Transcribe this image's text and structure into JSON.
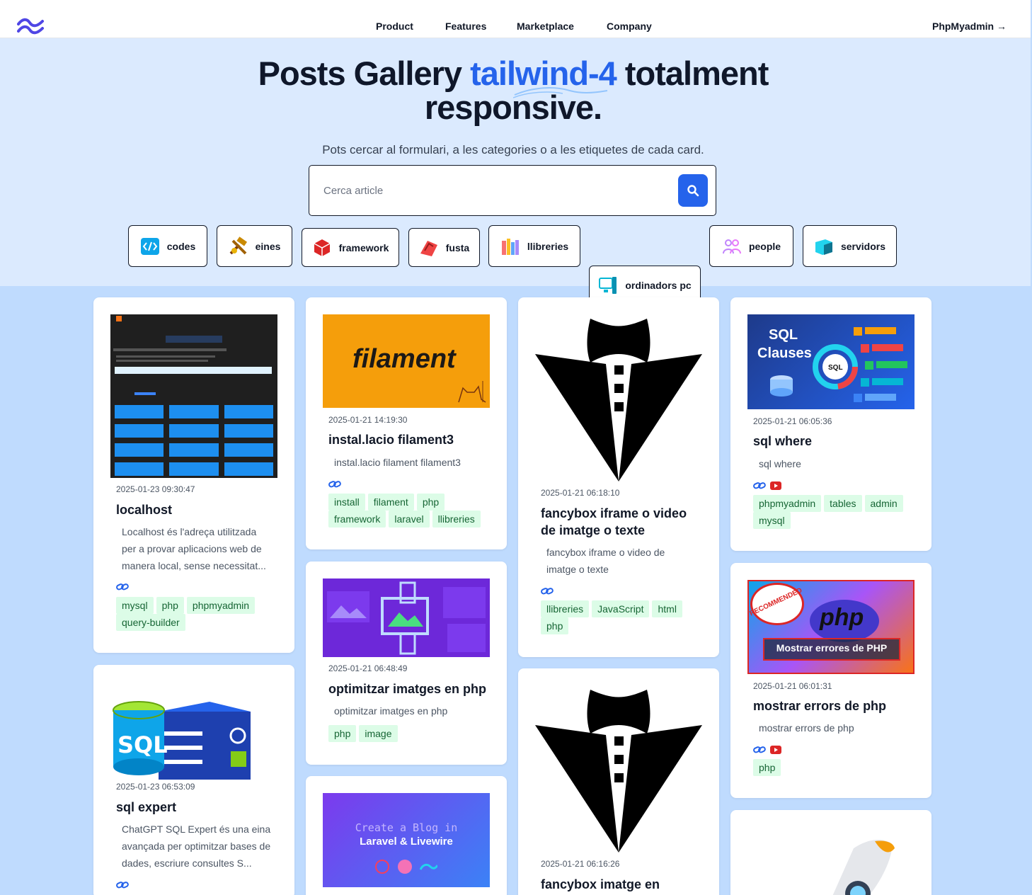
{
  "nav": {
    "items": [
      "Product",
      "Features",
      "Marketplace",
      "Company"
    ],
    "login": "PhpMyadmin →"
  },
  "hero": {
    "title_part1": "Posts Gallery",
    "title_accent": "tailwind-4",
    "title_part2": "totalment",
    "title_line2": "responsive.",
    "subtitle": "Pots cercar al formulari, a les categories o a les etiquetes de cada card."
  },
  "search": {
    "placeholder": "Cerca article"
  },
  "categories": [
    "codes",
    "eines",
    "framework",
    "fusta",
    "llibreries",
    "ordinadors pc",
    "people",
    "servidors"
  ],
  "colors": {
    "primary": "#2563eb",
    "hero_bg": "#dbeafe",
    "page_bg": "#bfdbfe",
    "tag_bg": "#dcfce7",
    "tag_text": "#166534"
  },
  "cards": [
    {
      "date": "2025-01-23 09:30:47",
      "title": "localhost",
      "desc": "Localhost és l'adreça utilitzada per a provar aplicacions web de manera local, sense necessitat...",
      "tags": [
        "mysql",
        "php",
        "phpmyadmin",
        "query-builder"
      ],
      "links": [
        "link-icon"
      ]
    },
    {
      "date": "2025-01-21 14:19:30",
      "title": "instal.lacio filament3",
      "desc": "instal.lacio filament filament3",
      "thumb_text": "filament",
      "tags": [
        "install",
        "filament",
        "php",
        "framework",
        "laravel",
        "llibreries"
      ],
      "links": [
        "link-icon"
      ]
    },
    {
      "date": "2025-01-21 06:18:10",
      "title": "fancybox iframe o video de imatge o texte",
      "desc": "fancybox iframe o video de imatge o texte",
      "tags": [
        "llibreries",
        "JavaScript",
        "html",
        "php"
      ],
      "links": [
        "link-icon"
      ]
    },
    {
      "date": "2025-01-21 06:05:36",
      "title": "sql where",
      "desc": "sql where",
      "thumb_text1": "SQL",
      "thumb_text2": "Clauses",
      "thumb_badge": "SQL",
      "tags": [
        "phpmyadmin",
        "tables",
        "admin",
        "mysql"
      ],
      "links": [
        "link-icon",
        "youtube-icon"
      ]
    },
    {
      "date": "2025-01-23 06:53:09",
      "title": "sql expert",
      "desc": "ChatGPT SQL Expert és una eina avançada per optimitzar bases de dades, escriure consultes S...",
      "thumb_text": "SQL",
      "tags": [],
      "links": [
        "link-icon"
      ]
    },
    {
      "date": "2025-01-21 06:48:49",
      "title": "optimitzar imatges en php",
      "desc": "optimitzar imatges en php",
      "tags": [
        "php",
        "image"
      ],
      "links": []
    },
    {
      "date": "2025-01-21 06:01:31",
      "title": "mostrar errors de php",
      "desc": "mostrar errors de php",
      "thumb_text1": "php",
      "thumb_text2": "Mostrar errores de PHP",
      "thumb_stamp": "RECOMMENDED",
      "tags": [
        "php"
      ],
      "links": [
        "link-icon",
        "youtube-icon"
      ]
    },
    {
      "title": "",
      "thumb_text1": "Create a Blog in",
      "thumb_text2": "Laravel & Livewire"
    },
    {
      "date": "2025-01-21 06:16:26",
      "title": "fancybox imatge en"
    }
  ]
}
